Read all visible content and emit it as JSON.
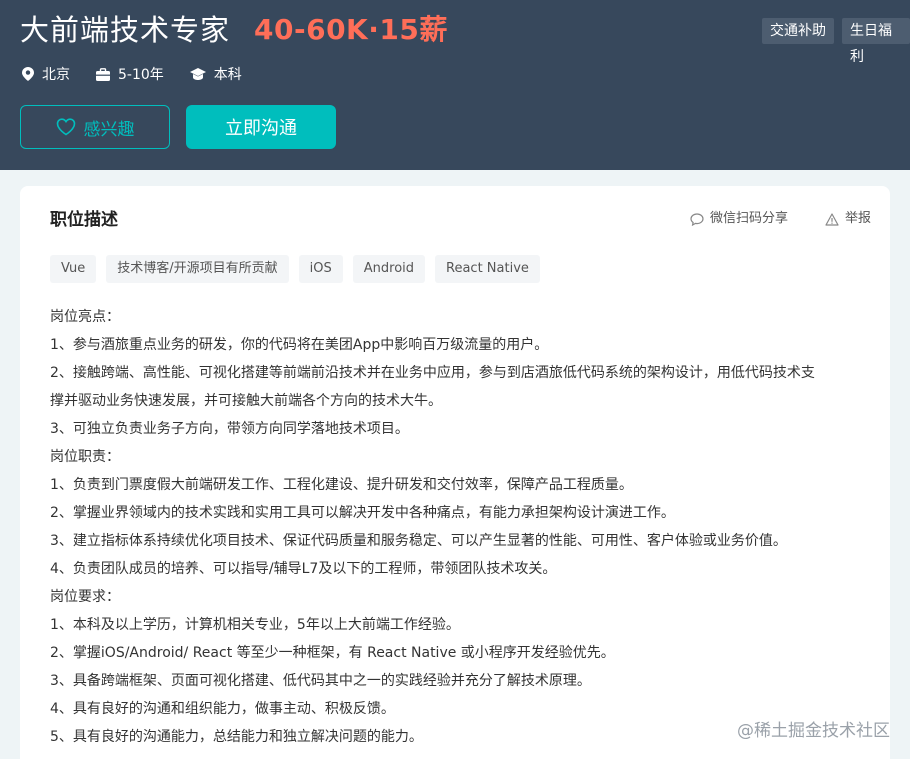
{
  "header": {
    "title": "大前端技术专家",
    "salary": "40-60K·15薪",
    "benefits": [
      "交通补助",
      "生日福利"
    ],
    "meta": {
      "location": "北京",
      "experience": "5-10年",
      "education": "本科"
    },
    "interest_label": "感兴趣",
    "chat_label": "立即沟通"
  },
  "description": {
    "title": "职位描述",
    "share_label": "微信扫码分享",
    "report_label": "举报",
    "tags": [
      "Vue",
      "技术博客/开源项目有所贡献",
      "iOS",
      "Android",
      "React Native"
    ],
    "lines": [
      "岗位亮点：",
      "1、参与酒旅重点业务的研发，你的代码将在美团App中影响百万级流量的用户。",
      "2、接触跨端、高性能、可视化搭建等前端前沿技术并在业务中应用，参与到店酒旅低代码系统的架构设计，用低代码技术支",
      "撑并驱动业务快速发展，并可接触大前端各个方向的技术大牛。",
      "3、可独立负责业务子方向，带领方向同学落地技术项目。",
      "岗位职责：",
      "1、负责到门票度假大前端研发工作、工程化建设、提升研发和交付效率，保障产品工程质量。",
      "2、掌握业界领域内的技术实践和实用工具可以解决开发中各种痛点，有能力承担架构设计演进工作。",
      "3、建立指标体系持续优化项目技术、保证代码质量和服务稳定、可以产生显著的性能、可用性、客户体验或业务价值。",
      "4、负责团队成员的培养、可以指导/辅导L7及以下的工程师，带领团队技术攻关。",
      "岗位要求：",
      "1、本科及以上学历，计算机相关专业，5年以上大前端工作经验。",
      "2、掌握iOS/Android/ React 等至少一种框架，有 React Native 或小程序开发经验优先。",
      "3、具备跨端框架、页面可视化搭建、低代码其中之一的实践经验并充分了解技术原理。",
      "4、具有良好的沟通和组织能力，做事主动、积极反馈。",
      "5、具有良好的沟通能力，总结能力和独立解决问题的能力。"
    ]
  },
  "watermark": "@稀土掘金技术社区",
  "colors": {
    "header_bg": "#37485c",
    "accent": "#00bebd",
    "salary": "#ff6e58"
  }
}
